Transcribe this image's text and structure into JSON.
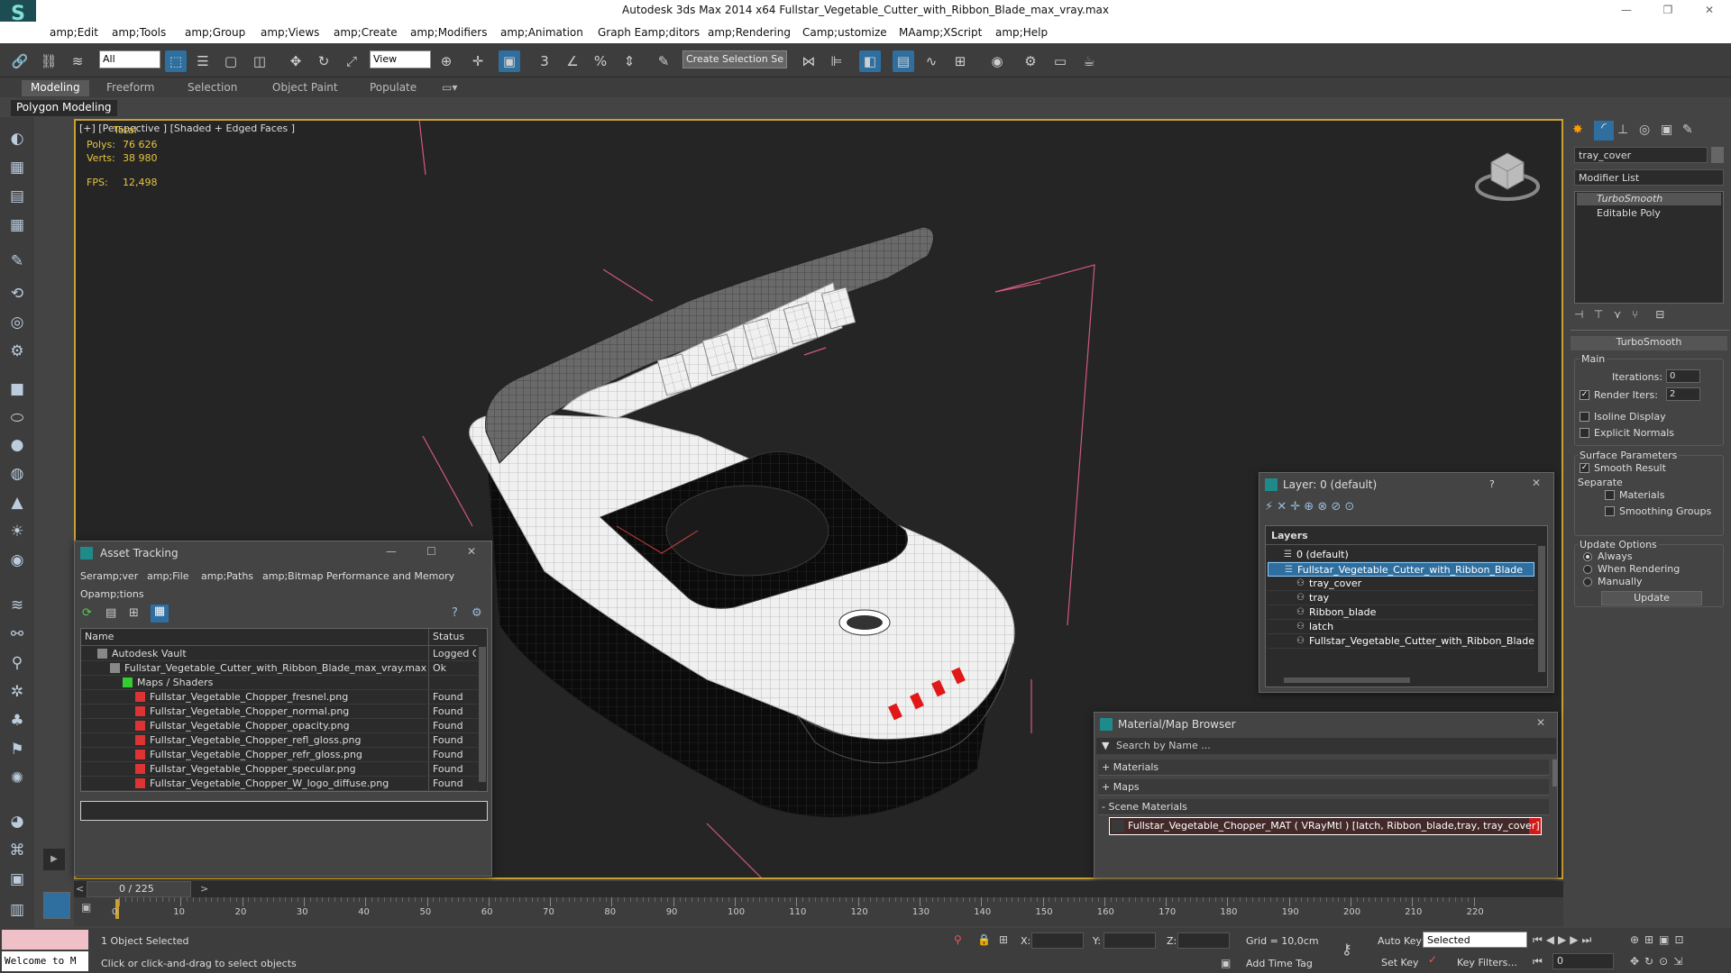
{
  "window": {
    "title": "Autodesk 3ds Max  2014 x64     Fullstar_Vegetable_Cutter_with_Ribbon_Blade_max_vray.max",
    "app_icon": "3ds-max-logo-icon"
  },
  "menu": [
    "amp;Edit",
    "amp;Tools",
    "amp;Group",
    "amp;Views",
    "amp;Create",
    "amp;Modifiers",
    "amp;Animation",
    "Graph Eamp;ditors",
    "amp;Rendering",
    "Camp;ustomize",
    "MAamp;XScript",
    "amp;Help"
  ],
  "toolbar": {
    "selection_filter": "All",
    "reference_coord": "View",
    "named_selection_placeholder": "Create Selection Se"
  },
  "ribbon": {
    "tabs": [
      "Modeling",
      "Freeform",
      "Selection",
      "Object Paint",
      "Populate"
    ],
    "panel_label": "Polygon Modeling"
  },
  "viewport": {
    "label": "[+] [Perspective ] [Shaded + Edged Faces ]",
    "stats": {
      "total_label": "Total",
      "polys_label": "Polys:",
      "polys_value": "76 626",
      "verts_label": "Verts:",
      "verts_value": "38 980",
      "fps_label": "FPS:",
      "fps_value": "12,498"
    }
  },
  "command_panel": {
    "object_name": "tray_cover",
    "modifier_list": "Modifier List",
    "stack": [
      "TurboSmooth",
      "Editable Poly"
    ],
    "rollout_title": "TurboSmooth",
    "main_label": "Main",
    "iterations_label": "Iterations:",
    "iterations_value": "0",
    "render_iters_label": "Render Iters:",
    "render_iters_value": "2",
    "isoline_label": "Isoline Display",
    "explicit_normals_label": "Explicit Normals",
    "surface_params_label": "Surface Parameters",
    "smooth_result_label": "Smooth Result",
    "separate_label": "Separate",
    "materials_label": "Materials",
    "smoothing_groups_label": "Smoothing Groups",
    "update_options_label": "Update Options",
    "always_label": "Always",
    "when_rendering_label": "When Rendering",
    "manually_label": "Manually",
    "update_button": "Update"
  },
  "asset_tracking": {
    "title": "Asset Tracking",
    "menu": [
      "Seramp;ver",
      "amp;File",
      "amp;Paths",
      "amp;Bitmap Performance and Memory",
      "Opamp;tions"
    ],
    "col_name": "Name",
    "col_status": "Status",
    "rows": [
      {
        "name": "Autodesk Vault",
        "status": "Logged O",
        "indent": 1,
        "icon": "vault-icon"
      },
      {
        "name": "Fullstar_Vegetable_Cutter_with_Ribbon_Blade_max_vray.max",
        "status": "Ok",
        "indent": 2,
        "icon": "max-file-icon"
      },
      {
        "name": "Maps / Shaders",
        "status": "",
        "indent": 3,
        "icon": "maps-folder-icon"
      },
      {
        "name": "Fullstar_Vegetable_Chopper_fresnel.png",
        "status": "Found",
        "indent": 4,
        "icon": "png-file-icon"
      },
      {
        "name": "Fullstar_Vegetable_Chopper_normal.png",
        "status": "Found",
        "indent": 4,
        "icon": "png-file-icon"
      },
      {
        "name": "Fullstar_Vegetable_Chopper_opacity.png",
        "status": "Found",
        "indent": 4,
        "icon": "png-file-icon"
      },
      {
        "name": "Fullstar_Vegetable_Chopper_refl_gloss.png",
        "status": "Found",
        "indent": 4,
        "icon": "png-file-icon"
      },
      {
        "name": "Fullstar_Vegetable_Chopper_refr_gloss.png",
        "status": "Found",
        "indent": 4,
        "icon": "png-file-icon"
      },
      {
        "name": "Fullstar_Vegetable_Chopper_specular.png",
        "status": "Found",
        "indent": 4,
        "icon": "png-file-icon"
      },
      {
        "name": "Fullstar_Vegetable_Chopper_W_logo_diffuse.png",
        "status": "Found",
        "indent": 4,
        "icon": "png-file-icon"
      }
    ]
  },
  "layer_dialog": {
    "title": "Layer: 0 (default)",
    "help": "?",
    "header": "Layers",
    "layers": [
      {
        "name": "0 (default)",
        "level": 0,
        "selected": false
      },
      {
        "name": "Fullstar_Vegetable_Cutter_with_Ribbon_Blade",
        "level": 0,
        "selected": true
      },
      {
        "name": "tray_cover",
        "level": 1,
        "selected": false
      },
      {
        "name": "tray",
        "level": 1,
        "selected": false
      },
      {
        "name": "Ribbon_blade",
        "level": 1,
        "selected": false
      },
      {
        "name": "latch",
        "level": 1,
        "selected": false
      },
      {
        "name": "Fullstar_Vegetable_Cutter_with_Ribbon_Blade",
        "level": 1,
        "selected": false
      }
    ]
  },
  "material_browser": {
    "title": "Material/Map Browser",
    "search_placeholder": "Search by Name ...",
    "groups": [
      "+ Materials",
      "+ Maps",
      "- Scene Materials"
    ],
    "scene_material": "Fullstar_Vegetable_Chopper_MAT ( VRayMtl ) [latch, Ribbon_blade,tray, tray_cover]"
  },
  "timeline": {
    "frame_counter": "0 / 225",
    "ticks": [
      "0",
      "10",
      "20",
      "30",
      "40",
      "50",
      "60",
      "70",
      "80",
      "90",
      "100",
      "110",
      "120",
      "130",
      "140",
      "150",
      "160",
      "170",
      "180",
      "190",
      "200",
      "210",
      "220"
    ]
  },
  "status": {
    "welcome": "Welcome to M",
    "selected_count": "1 Object Selected",
    "prompt": "Click or click-and-drag to select objects",
    "x_label": "X:",
    "y_label": "Y:",
    "z_label": "Z:",
    "grid": "Grid = 10,0cm",
    "add_time_tag": "Add Time Tag",
    "auto_key": "Auto Key",
    "set_key": "Set Key",
    "key_mode": "Selected",
    "key_filters": "Key Filters...",
    "frame_value": "0"
  },
  "colors": {
    "accent": "#2e6f9f",
    "viewport_border": "#c9a032",
    "stats_text": "#e5c440",
    "material_highlight": "#d11b1b"
  }
}
